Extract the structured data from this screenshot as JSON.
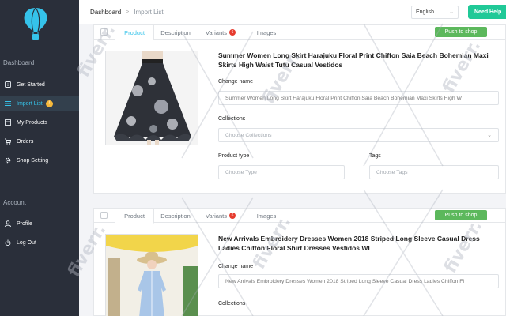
{
  "sidebar": {
    "section_dashboard": "Dashboard",
    "items": [
      {
        "label": "Get Started",
        "icon": "info-icon"
      },
      {
        "label": "Import List",
        "icon": "list-icon",
        "badge": "!"
      },
      {
        "label": "My Products",
        "icon": "products-icon"
      },
      {
        "label": "Orders",
        "icon": "cart-icon"
      },
      {
        "label": "Shop Setting",
        "icon": "gear-icon"
      }
    ],
    "section_account": "Account",
    "account_items": [
      {
        "label": "Profile",
        "icon": "user-icon"
      },
      {
        "label": "Log Out",
        "icon": "power-icon"
      }
    ]
  },
  "header": {
    "breadcrumb": [
      "Dashboard",
      "Import List"
    ],
    "language": "English",
    "help_label": "Need Help"
  },
  "tabs": {
    "product": "Product",
    "description": "Description",
    "variants": "Variants",
    "images": "Images"
  },
  "push_label": "Push to shop",
  "fields": {
    "change_name": "Change name",
    "collections": "Collections",
    "collections_placeholder": "Choose Collections",
    "product_type": "Product type",
    "type_placeholder": "Choose Type",
    "tags": "Tags",
    "tags_placeholder": "Choose Tags"
  },
  "products": [
    {
      "title": "Summer Women Long Skirt Harajuku Floral Print Chiffon Saia Beach Bohemian Maxi Skirts High Waist Tutu Casual Vestidos",
      "name_value": "Summer Women Long Skirt Harajuku Floral Print Chiffon Saia Beach Bohemian Maxi Skirts High W",
      "variants_badge": "6"
    },
    {
      "title": "New Arrivals Embroidery Dresses Women 2018 Striped Long Sleeve Casual Dress Ladies Chiffon Floral Shirt Dresses Vestidos WI",
      "name_value": "New Arrivals Embroidery Dresses Women 2018 Striped Long Sleeve Casual Dress Ladies Chiffon Fl",
      "variants_badge": "6"
    }
  ],
  "watermark": "fiverr.",
  "colors": {
    "sidebar_bg": "#2a2f3a",
    "accent": "#35c3ea",
    "push_green": "#5cb85c",
    "help_green": "#20c997",
    "badge_red": "#e63b2e"
  }
}
